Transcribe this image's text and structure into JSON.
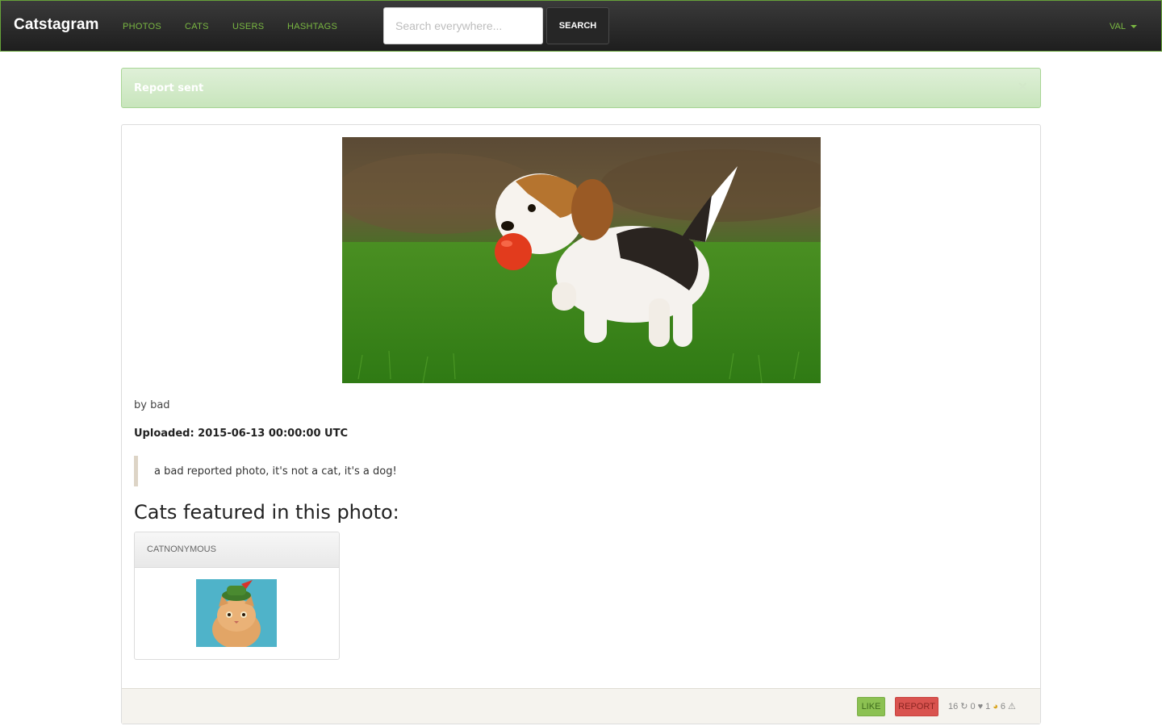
{
  "navbar": {
    "brand": "Catstagram",
    "links": [
      "PHOTOS",
      "CATS",
      "USERS",
      "HASHTAGS"
    ],
    "search_placeholder": "Search everywhere...",
    "search_button": "SEARCH",
    "user_menu": "VAL"
  },
  "alert": {
    "text": "Report sent",
    "close_label": "×"
  },
  "photo": {
    "author": "by bad",
    "uploaded": "Uploaded: 2015-06-13 00:00:00 UTC",
    "description": "a bad reported photo, it's not a cat, it's a dog!"
  },
  "featured": {
    "heading": "Cats featured in this photo:",
    "cats": [
      {
        "name": "CATNONYMOUS"
      }
    ]
  },
  "footer": {
    "like_label": "LIKE",
    "report_label": "REPORT",
    "stats": {
      "reposts": "16",
      "likes": "0",
      "cats": "1",
      "reports": "6"
    }
  },
  "colors": {
    "accent_green": "#7ab842",
    "alert_bg": "#dff0d8",
    "like_green": "#8cc152",
    "report_red": "#d9534f"
  },
  "icons": [
    "caret-down-icon",
    "close-icon",
    "repost-icon",
    "heart-icon",
    "cat-icon",
    "warning-icon"
  ]
}
